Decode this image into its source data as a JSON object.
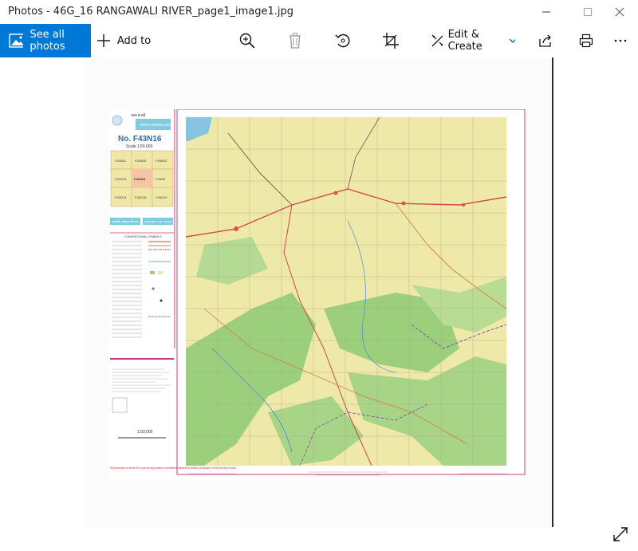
{
  "window": {
    "title": "Photos - 46G_16  RANGAWALI RIVER_page1_image1.jpg",
    "controls": {
      "minimize_icon": "minimize-icon",
      "maximize_icon": "maximize-icon",
      "close_icon": "close-icon"
    }
  },
  "toolbar": {
    "see_all_label": "See all photos",
    "add_to_label": "Add to",
    "edit_create_label": "Edit & Create",
    "icons": [
      "zoom-in-icon",
      "delete-icon",
      "rotate-icon",
      "crop-icon",
      "edit-create-icon",
      "share-icon",
      "print-icon",
      "more-icon"
    ]
  },
  "map": {
    "header_small": "भारत के सर्वे",
    "series": "OPEN SERIES MAP",
    "sheet_no": "No. F43N16",
    "scale": "Scale  1:50,000",
    "index_cells": [
      "F43N11",
      "F43N15",
      "F43N16",
      "F43N12",
      "F43O13",
      "F43O9",
      "F43O14",
      "F43O15",
      "F43O10"
    ],
    "dept_hindi": "भारतीय सर्वेक्षण विभाग",
    "dept_english": "SURVEY OF INDIA",
    "legend_title": "CONVENTIONAL SYMBOLS",
    "scale_bottom": "1:50,000",
    "warning_text": "Reproduction in whole or in part by any means is prohibited without the written permission of the Survey of India"
  },
  "colors": {
    "accent": "#0078d7",
    "map_land": "#eee9a8",
    "map_forest": "#9ccf7c",
    "map_water": "#87c4e4",
    "map_border": "#c53d80"
  }
}
